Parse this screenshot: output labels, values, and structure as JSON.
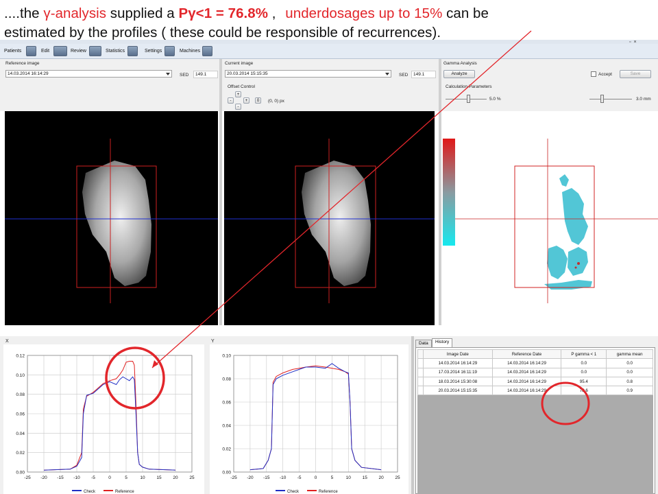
{
  "caption": {
    "prefix": "....the ",
    "gamma_symbol": "γ",
    "analysis_text": "-analysis",
    "mid_text": " supplied a ",
    "p_gamma": "Pγ<1 = 76.8%",
    "comma": " , ",
    "underdosage_text": "underdosages up to 15%",
    "rest_line1": " can be",
    "line2": "estimated by the profiles ( these could be responsible of recurrences)."
  },
  "toolbar": {
    "items": [
      "Patients",
      "Edit",
      "Review",
      "Statistics",
      "Settings",
      "Machines"
    ]
  },
  "reference_panel": {
    "label": "Reference image",
    "selected_date": "14.03.2014 16:14:29",
    "sed_label": "SED",
    "sed_value": "149.1"
  },
  "current_panel": {
    "label": "Current image",
    "selected_date": "20.03.2014 15:15:35",
    "sed_label": "SED",
    "sed_value": "149.1",
    "offset_label": "Offset Control",
    "offset_value": "(0, 0) px",
    "btn_up": "+",
    "btn_left": "-",
    "btn_right": "+",
    "btn_down": "-",
    "btn_zero": "0"
  },
  "gamma_panel": {
    "label": "Gamma Analysis",
    "analyze_button": "Analyze",
    "accept_label": "Accept",
    "save_button": "Save",
    "calc_params_label": "Calculation Parameters",
    "dose_value": "5.0 %",
    "distance_value": "3.0 mm"
  },
  "profile_x": {
    "label": "X",
    "legend": [
      "Check",
      "Reference"
    ]
  },
  "profile_y": {
    "label": "Y",
    "legend": [
      "Check",
      "Reference"
    ]
  },
  "history": {
    "tabs": [
      "Data",
      "History"
    ],
    "columns": [
      "Image Date",
      "Reference Date",
      "P gamma < 1",
      "gamma mean"
    ],
    "rows": [
      [
        "14.03.2014 16:14:29",
        "14.03.2014 16:14:29",
        "0.0",
        "0.0"
      ],
      [
        "17.03.2014 16:11:19",
        "14.03.2014 16:14:29",
        "0.0",
        "0.0"
      ],
      [
        "18.03.2014 15:30:08",
        "14.03.2014 16:14:29",
        "95.4",
        "0.8"
      ],
      [
        "20.03.2014 15:15:35",
        "14.03.2014 16:14:29",
        "78.6",
        "0.9"
      ]
    ]
  },
  "colors": {
    "check": "#1f2ec4",
    "reference": "#e02020",
    "annotation": "#e2262b",
    "crosshair_v": "#c82020",
    "crosshair_h": "#2030d0"
  },
  "chart_data": [
    {
      "type": "line",
      "xlabel": "",
      "ylabel": "",
      "xlim": [
        -25,
        25
      ],
      "ylim": [
        0,
        0.12
      ],
      "x_ticks": [
        -25,
        -20,
        -15,
        -10,
        -5,
        0,
        5,
        10,
        15,
        20,
        25
      ],
      "y_ticks": [
        0.0,
        0.02,
        0.04,
        0.06,
        0.08,
        0.1,
        0.12
      ],
      "series": [
        {
          "name": "Check",
          "x": [
            -20,
            -12,
            -10,
            -8.5,
            -8,
            -7,
            -6,
            -5,
            -4,
            -2,
            0,
            2,
            3,
            4,
            5,
            6,
            7,
            7.5,
            8,
            8.5,
            9,
            10,
            12,
            20
          ],
          "y": [
            0.002,
            0.003,
            0.006,
            0.015,
            0.06,
            0.079,
            0.08,
            0.081,
            0.084,
            0.09,
            0.093,
            0.09,
            0.095,
            0.098,
            0.096,
            0.094,
            0.098,
            0.095,
            0.06,
            0.02,
            0.008,
            0.005,
            0.003,
            0.002
          ]
        },
        {
          "name": "Reference",
          "x": [
            -20,
            -12,
            -10,
            -8.5,
            -8,
            -7,
            -6,
            -5,
            -4,
            -2,
            0,
            2,
            3,
            4,
            5,
            6,
            7,
            7.5,
            8,
            8.5,
            9,
            10,
            12,
            20
          ],
          "y": [
            0.002,
            0.003,
            0.007,
            0.02,
            0.065,
            0.078,
            0.08,
            0.082,
            0.085,
            0.091,
            0.094,
            0.096,
            0.1,
            0.105,
            0.113,
            0.114,
            0.114,
            0.11,
            0.07,
            0.02,
            0.008,
            0.005,
            0.003,
            0.002
          ]
        }
      ]
    },
    {
      "type": "line",
      "xlabel": "",
      "ylabel": "",
      "xlim": [
        -25,
        25
      ],
      "ylim": [
        0,
        0.1
      ],
      "x_ticks": [
        -25,
        -20,
        -15,
        -10,
        -5,
        0,
        5,
        10,
        15,
        20,
        25
      ],
      "y_ticks": [
        0.0,
        0.02,
        0.04,
        0.06,
        0.08,
        0.1
      ],
      "series": [
        {
          "name": "Check",
          "x": [
            -20,
            -16,
            -14.5,
            -13.5,
            -13,
            -12,
            -10,
            -7,
            -5,
            -3,
            0,
            3,
            5,
            7,
            9,
            10,
            10.5,
            11,
            12,
            14,
            20
          ],
          "y": [
            0.002,
            0.003,
            0.01,
            0.02,
            0.075,
            0.08,
            0.083,
            0.086,
            0.088,
            0.09,
            0.09,
            0.089,
            0.093,
            0.089,
            0.086,
            0.085,
            0.06,
            0.02,
            0.01,
            0.004,
            0.002
          ]
        },
        {
          "name": "Reference",
          "x": [
            -20,
            -16,
            -14.5,
            -13.5,
            -13,
            -12,
            -10,
            -7,
            -5,
            -3,
            0,
            3,
            5,
            7,
            9,
            10,
            10.5,
            11,
            12,
            14,
            20
          ],
          "y": [
            0.002,
            0.003,
            0.01,
            0.02,
            0.077,
            0.082,
            0.085,
            0.088,
            0.089,
            0.09,
            0.091,
            0.09,
            0.089,
            0.088,
            0.086,
            0.084,
            0.06,
            0.02,
            0.01,
            0.004,
            0.002
          ]
        }
      ]
    }
  ]
}
